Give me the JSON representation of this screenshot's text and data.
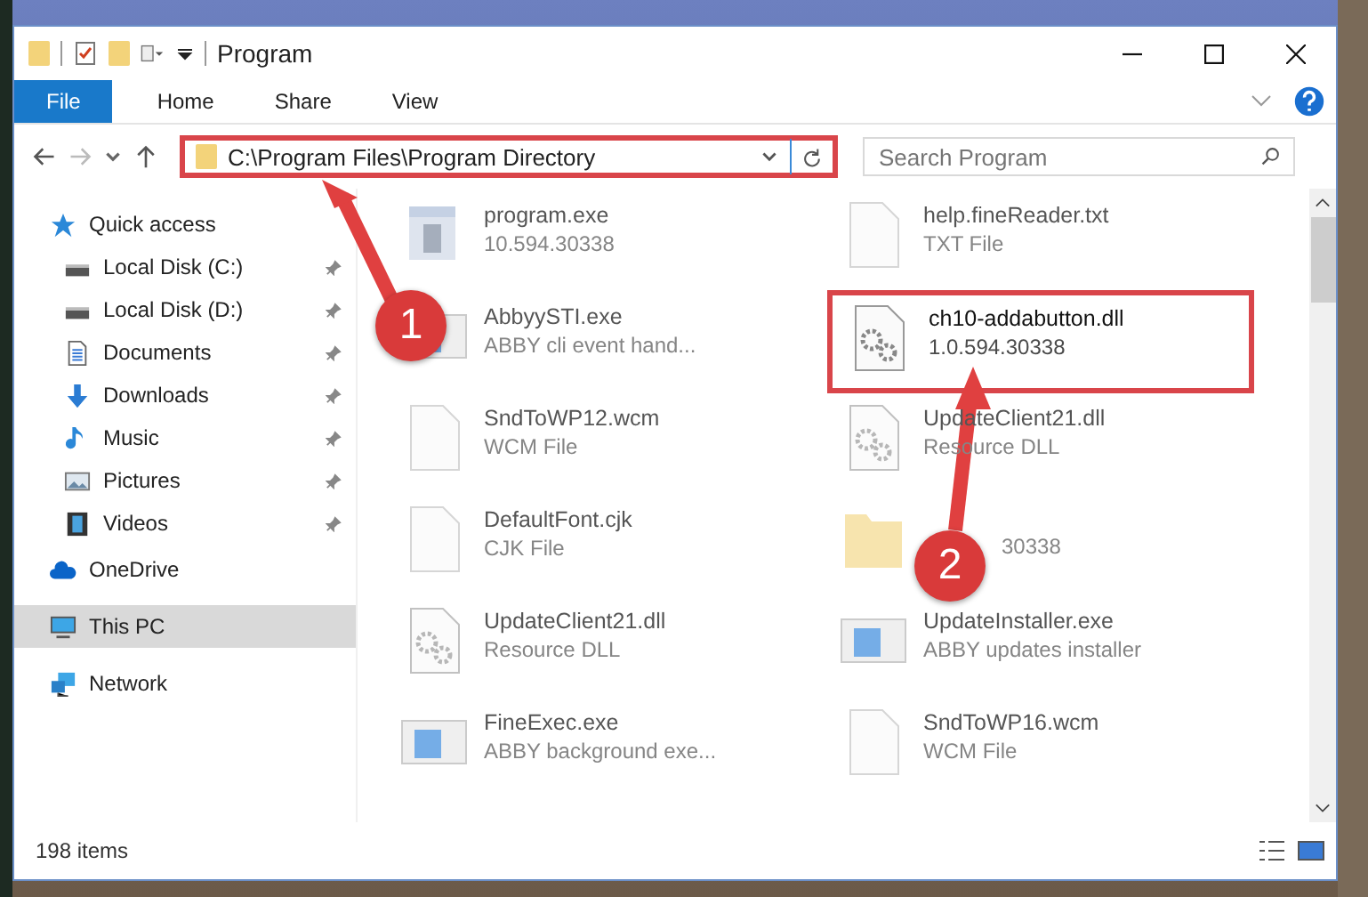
{
  "window": {
    "title": "Program"
  },
  "ribbon_tabs": [
    {
      "label": "File",
      "selected": true
    },
    {
      "label": "Home",
      "selected": false
    },
    {
      "label": "Share",
      "selected": false
    },
    {
      "label": "View",
      "selected": false
    }
  ],
  "address": {
    "value": "C:\\Program Files\\Program Directory",
    "highlighted": true
  },
  "search": {
    "placeholder": "Search Program"
  },
  "sidebar": {
    "items": [
      {
        "label": "Quick access",
        "kind": "star",
        "selected": false,
        "children": [
          {
            "label": "Local Disk (C:)",
            "kind": "drive",
            "pinned": true,
            "selected": false
          },
          {
            "label": "Local Disk (D:)",
            "kind": "drive",
            "pinned": true,
            "selected": false
          },
          {
            "label": "Documents",
            "kind": "document",
            "pinned": true,
            "selected": false
          },
          {
            "label": "Downloads",
            "kind": "download",
            "pinned": true,
            "selected": false
          },
          {
            "label": "Music",
            "kind": "music",
            "pinned": true,
            "selected": false
          },
          {
            "label": "Pictures",
            "kind": "pictures",
            "pinned": true,
            "selected": false
          },
          {
            "label": "Videos",
            "kind": "videos",
            "pinned": true,
            "selected": false
          }
        ]
      },
      {
        "label": "OneDrive",
        "kind": "cloud",
        "selected": false
      },
      {
        "label": "This PC",
        "kind": "pc",
        "selected": true
      },
      {
        "label": "Network",
        "kind": "network",
        "selected": false
      }
    ]
  },
  "files": [
    {
      "name": "program.exe",
      "detail": "10.594.30338",
      "kind": "app",
      "blurred": true,
      "highlighted": false
    },
    {
      "name": "help.fineReader.txt",
      "detail": "TXT File",
      "kind": "page",
      "blurred": true,
      "highlighted": false
    },
    {
      "name": "AbbyySTI.exe",
      "detail": "ABBY cli event hand...",
      "kind": "exe",
      "blurred": true,
      "highlighted": false
    },
    {
      "name": "ch10-addabutton.dll",
      "detail": "1.0.594.30338",
      "kind": "dll",
      "blurred": false,
      "highlighted": true
    },
    {
      "name": "SndToWP12.wcm",
      "detail": "WCM File",
      "kind": "page",
      "blurred": true,
      "highlighted": false
    },
    {
      "name": "UpdateClient21.dll",
      "detail": "Resource DLL",
      "kind": "dll",
      "blurred": true,
      "highlighted": false
    },
    {
      "name": "DefaultFont.cjk",
      "detail": "CJK File",
      "kind": "page",
      "blurred": true,
      "highlighted": false
    },
    {
      "detail": "30338",
      "kind": "folder",
      "blurred": true,
      "highlighted": false
    },
    {
      "name": "UpdateClient21.dll",
      "detail": "Resource DLL",
      "kind": "dll",
      "blurred": true,
      "highlighted": false
    },
    {
      "name": "UpdateInstaller.exe",
      "detail": "ABBY updates installer",
      "kind": "exe",
      "blurred": true,
      "highlighted": false
    },
    {
      "name": "FineExec.exe",
      "detail": "ABBY background exe...",
      "kind": "exe",
      "blurred": true,
      "highlighted": false
    },
    {
      "name": "SndToWP16.wcm",
      "detail": "WCM File",
      "kind": "page",
      "blurred": true,
      "highlighted": false
    }
  ],
  "status_bar": {
    "count": "198 items"
  },
  "callouts": [
    {
      "number": "1"
    },
    {
      "number": "2"
    }
  ]
}
